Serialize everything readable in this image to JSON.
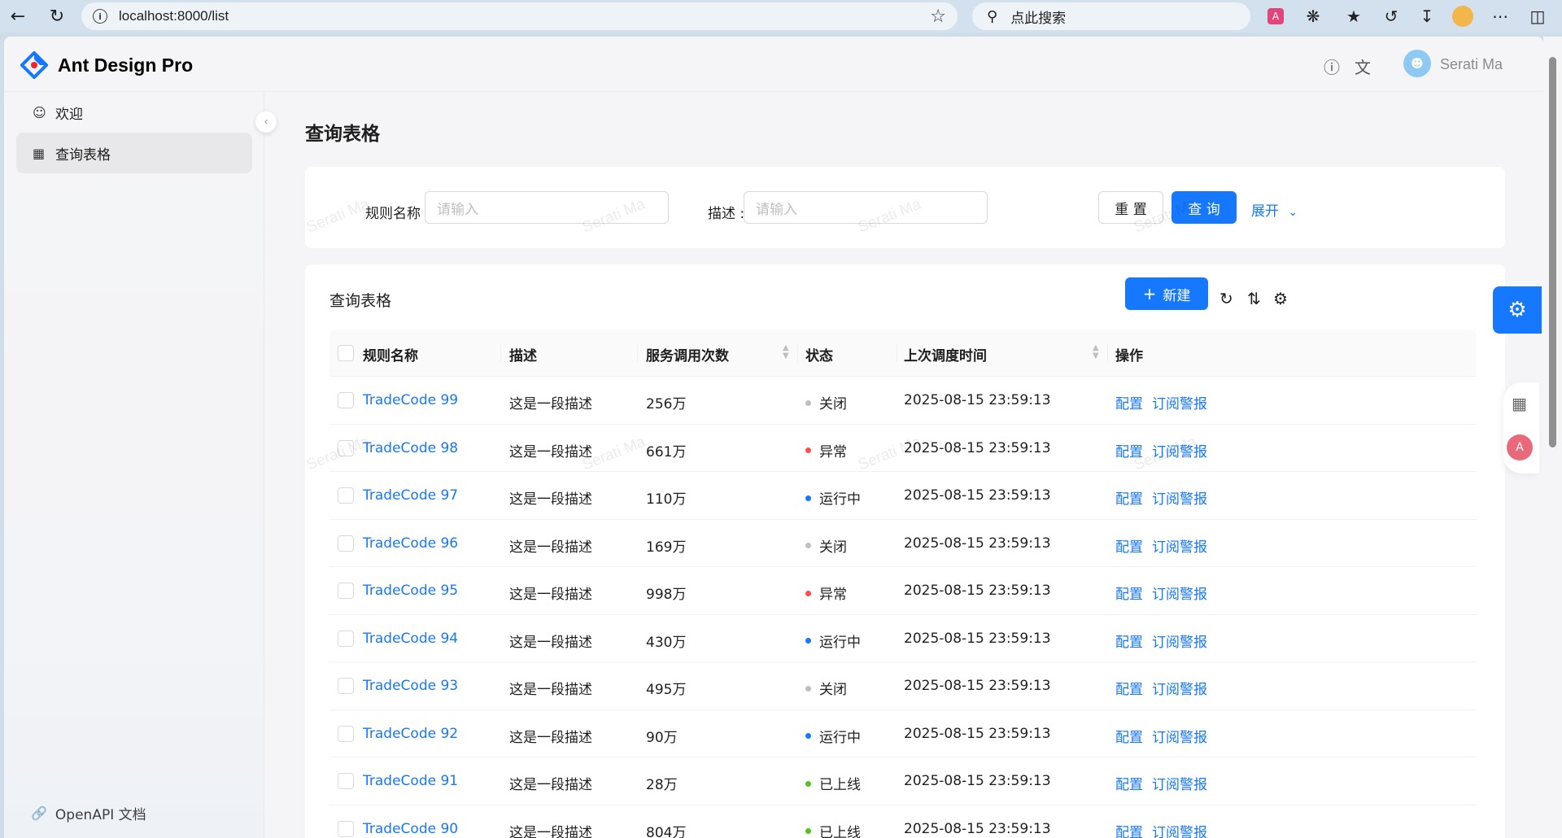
{
  "browser": {
    "url": "localhost:8000/list",
    "search_placeholder": "点此搜索"
  },
  "app": {
    "logo_text": "Ant Design Pro",
    "username": "Serati Ma",
    "watermark": "Serati Ma"
  },
  "sidebar": {
    "items": [
      {
        "label": "欢迎",
        "icon": "smile-icon"
      },
      {
        "label": "查询表格",
        "icon": "table-icon",
        "active": true
      }
    ],
    "footer_link": "OpenAPI 文档"
  },
  "page": {
    "title": "查询表格"
  },
  "search_form": {
    "rule_name_label": "规则名称 :",
    "rule_name_placeholder": "请输入",
    "desc_label": "描述 :",
    "desc_placeholder": "请输入",
    "reset_label": "重 置",
    "query_label": "查 询",
    "expand_label": "展开"
  },
  "table": {
    "title": "查询表格",
    "new_label": "新建",
    "columns": [
      "规则名称",
      "描述",
      "服务调用次数",
      "状态",
      "上次调度时间",
      "操作"
    ],
    "rows": [
      {
        "name": "TradeCode 99",
        "desc": "这是一段描述",
        "calls": "256万",
        "status": "关闭",
        "status_color": "#bfbfbf",
        "time": "2025-08-15 23:59:13",
        "action1": "配置",
        "action2": "订阅警报"
      },
      {
        "name": "TradeCode 98",
        "desc": "这是一段描述",
        "calls": "661万",
        "status": "异常",
        "status_color": "#ff4d4f",
        "time": "2025-08-15 23:59:13",
        "action1": "配置",
        "action2": "订阅警报"
      },
      {
        "name": "TradeCode 97",
        "desc": "这是一段描述",
        "calls": "110万",
        "status": "运行中",
        "status_color": "#1677ff",
        "time": "2025-08-15 23:59:13",
        "action1": "配置",
        "action2": "订阅警报"
      },
      {
        "name": "TradeCode 96",
        "desc": "这是一段描述",
        "calls": "169万",
        "status": "关闭",
        "status_color": "#bfbfbf",
        "time": "2025-08-15 23:59:13",
        "action1": "配置",
        "action2": "订阅警报"
      },
      {
        "name": "TradeCode 95",
        "desc": "这是一段描述",
        "calls": "998万",
        "status": "异常",
        "status_color": "#ff4d4f",
        "time": "2025-08-15 23:59:13",
        "action1": "配置",
        "action2": "订阅警报"
      },
      {
        "name": "TradeCode 94",
        "desc": "这是一段描述",
        "calls": "430万",
        "status": "运行中",
        "status_color": "#1677ff",
        "time": "2025-08-15 23:59:13",
        "action1": "配置",
        "action2": "订阅警报"
      },
      {
        "name": "TradeCode 93",
        "desc": "这是一段描述",
        "calls": "495万",
        "status": "关闭",
        "status_color": "#bfbfbf",
        "time": "2025-08-15 23:59:13",
        "action1": "配置",
        "action2": "订阅警报"
      },
      {
        "name": "TradeCode 92",
        "desc": "这是一段描述",
        "calls": "90万",
        "status": "运行中",
        "status_color": "#1677ff",
        "time": "2025-08-15 23:59:13",
        "action1": "配置",
        "action2": "订阅警报"
      },
      {
        "name": "TradeCode 91",
        "desc": "这是一段描述",
        "calls": "28万",
        "status": "已上线",
        "status_color": "#52c41a",
        "time": "2025-08-15 23:59:13",
        "action1": "配置",
        "action2": "订阅警报"
      },
      {
        "name": "TradeCode 90",
        "desc": "这是一段描述",
        "calls": "804万",
        "status": "已上线",
        "status_color": "#52c41a",
        "time": "2025-08-15 23:59:13",
        "action1": "配置",
        "action2": "订阅警报"
      }
    ]
  }
}
